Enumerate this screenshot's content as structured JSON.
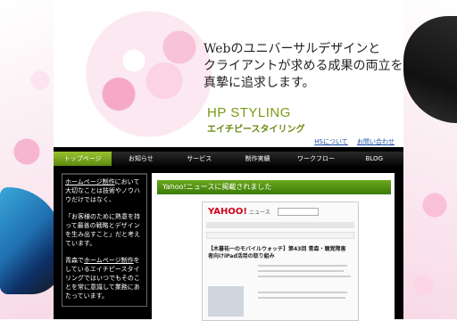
{
  "header": {
    "tagline_line1": "Webのユニバーサルデザインと",
    "tagline_line2": "クライアントが求める成果の両立を",
    "tagline_line3": "真摯に追求します。",
    "logo": "HP STYLING",
    "logo_sub": "エイチピースタイリング",
    "links": [
      "HSについて",
      "お問い合わせ"
    ]
  },
  "nav": [
    "トップページ",
    "お知らせ",
    "サービス",
    "制作実績",
    "ワークフロー",
    "BLOG"
  ],
  "sidebar": {
    "p1_link": "ホームページ制作",
    "p1_text": "において大切なことは技術やノウハウだけではなく、",
    "p2": "「お客様のために熱意を持って最善の戦略とデザインを生み出すこと」だと考えています。",
    "p3_pre": "青森で",
    "p3_link": "ホームページ制作",
    "p3_post": "をしているエイチピースタイリングではいつでもそのことを常に意識して業務にあたっています。"
  },
  "content": {
    "title": "Yahoo!ニュースに掲載されました",
    "screenshot": {
      "logo": "YAHOO!",
      "section": "ニュース",
      "headline": "【木暮祐一のモバイルウォッチ】第43回 青森・聴覚障害者向けiPad活用の取り組み"
    }
  },
  "colors": {
    "nav_active": "#7aa81f",
    "title_bar": "#4f8f12",
    "link": "#1a4fa3"
  }
}
